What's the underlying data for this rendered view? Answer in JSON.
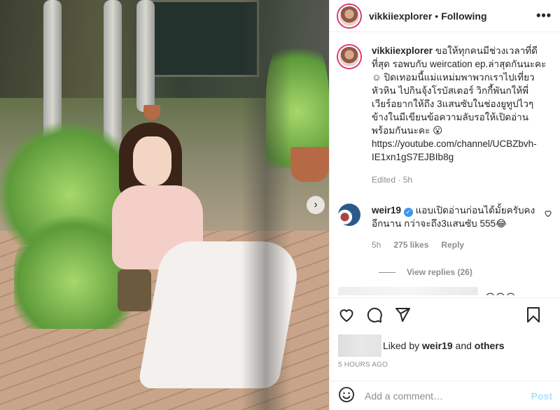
{
  "header": {
    "username": "vikkiiexplorer",
    "separator": "•",
    "follow_label": "Following",
    "more": "•••"
  },
  "caption": {
    "username": "vikkiiexplorer",
    "text": "ขอให้ทุกคนมีช่วงเวลาที่ดีที่สุด รอพบกับ weircation ep.ล่าสุดกันนะคะ ☺ ปิดเทอมนี้แม่แหม่มพาพวกเราไปเที่ยวหัวหิน ไปกินจุ้งโรบัสเตอร์ วิกกี้พันกให้พี่เวียร์อยากให้ถึง 3แสนซับในช่องยูทูปไวๆ ข้างในมีเขียนข้อความลับรอให้เปิดอ่านพร้อมกันนะคะ 😮 https://youtube.com/channel/UCBZbvh-IE1xn1gS7EJBIb8g",
    "meta": "Edited · 5h"
  },
  "comment": {
    "username": "weir19",
    "verified": "✓",
    "text": "แอบเปิดอ่านก่อนได้มั้ยครับคงอีกนาน กว่าจะถึง3แสนซับ 555😂",
    "time": "5h",
    "likes": "275 likes",
    "reply": "Reply",
    "view_replies": "View replies (26)"
  },
  "blurred_comment_emojis": "😍😍😍",
  "carousel_arrow": "›",
  "likes": {
    "prefix": "Liked by ",
    "user": "weir19",
    "mid": " and ",
    "others": "others"
  },
  "timestamp": "5 HOURS AGO",
  "add_comment": {
    "placeholder": "Add a comment…",
    "post_label": "Post",
    "emoji": "☺"
  },
  "colors": {
    "ring": "#e1306c",
    "verified": "#3897f0",
    "post_disabled": "#b2dffc"
  }
}
